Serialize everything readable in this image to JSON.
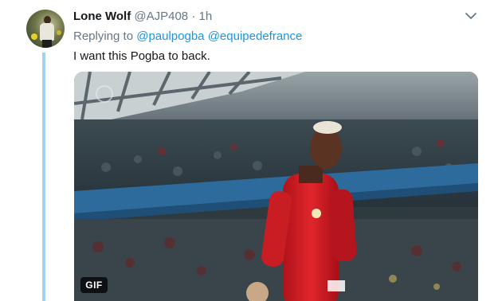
{
  "tweet": {
    "display_name": "Lone Wolf",
    "handle": "@AJP408",
    "separator": "·",
    "time": "1h",
    "replying_prefix": "Replying to",
    "mentions": [
      "@paulpogba",
      "@equipedefrance"
    ],
    "text": "I want this Pogba to back.",
    "media": {
      "badge": "GIF",
      "icon": "gif-media"
    },
    "menu_icon": "chevron-down-icon"
  },
  "colors": {
    "name": "#14171a",
    "secondary": "#657786",
    "link": "#1b95e0",
    "thread_line": "#9fd3f0"
  }
}
